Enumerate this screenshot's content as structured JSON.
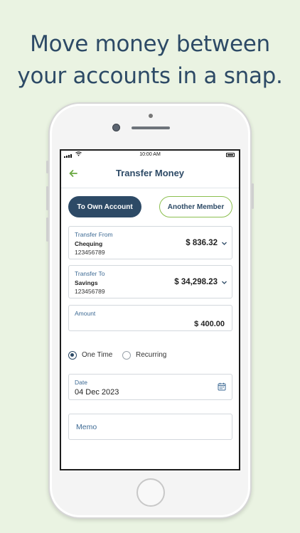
{
  "headline": {
    "line1": "Move money between",
    "line2": "your accounts in a snap."
  },
  "status_bar": {
    "time": "10:00 AM"
  },
  "header": {
    "title": "Transfer Money"
  },
  "tabs": [
    {
      "label": "To Own Account",
      "active": true
    },
    {
      "label": "Another Member",
      "active": false
    }
  ],
  "transfer_from": {
    "label": "Transfer From",
    "account_name": "Chequing",
    "account_number": "123456789",
    "balance": "$ 836.32"
  },
  "transfer_to": {
    "label": "Transfer To",
    "account_name": "Savings",
    "account_number": "123456789",
    "balance": "$ 34,298.23"
  },
  "amount": {
    "label": "Amount",
    "value": "$ 400.00"
  },
  "frequency": {
    "options": [
      "One Time",
      "Recurring"
    ],
    "selected": "One Time"
  },
  "date": {
    "label": "Date",
    "value": "04 Dec 2023"
  },
  "memo": {
    "placeholder": "Memo"
  },
  "colors": {
    "primary": "#2d4a66",
    "accent_green": "#8cbf4f",
    "background": "#eaf3e2"
  }
}
